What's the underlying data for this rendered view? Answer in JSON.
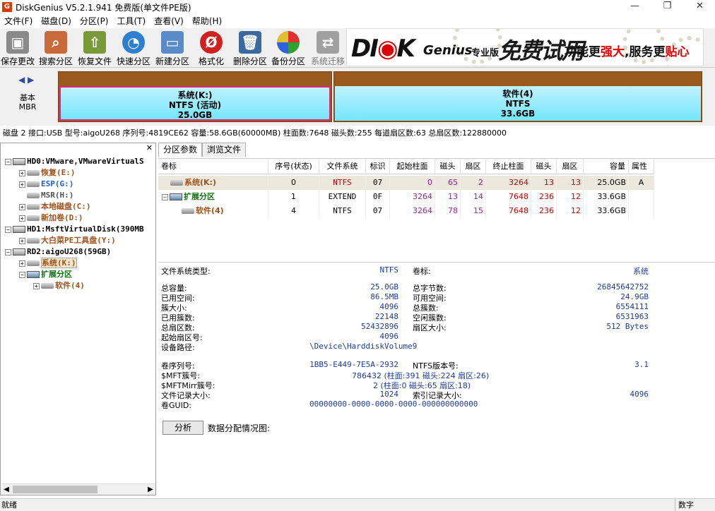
{
  "window": {
    "title": "DiskGenius V5.2.1.941 免费版(单文件PE版)"
  },
  "menu": [
    "文件(F)",
    "磁盘(D)",
    "分区(P)",
    "工具(T)",
    "查看(V)",
    "帮助(H)"
  ],
  "toolbar": {
    "save": "保存更改",
    "search": "搜索分区",
    "recover": "恢复文件",
    "quick": "快速分区",
    "new": "新建分区",
    "format": "格式化",
    "delete": "删除分区",
    "backup": "备份分区",
    "migrate": "系统迁移"
  },
  "banner": {
    "brand_a": "DI",
    "brand_b": "K",
    "brand_c": "Genius",
    "edition": "专业版",
    "trial": "免费试用",
    "slogan_a": "功能更",
    "slogan_b": "强大",
    "slogan_c": ",服务更",
    "slogan_d": "贴心"
  },
  "disk_view": {
    "type_label": "基本",
    "scheme_label": "MBR",
    "partitions": [
      {
        "name": "系统(K:)",
        "fs": "NTFS (活动)",
        "size": "25.0GB"
      },
      {
        "name": "软件(4)",
        "fs": "NTFS",
        "size": "33.6GB"
      }
    ]
  },
  "disk_info": "磁盘 2 接口:USB  型号:aigoU268  序列号:4819CE62  容量:58.6GB(60000MB)  柱面数:7648  磁头数:255  每道扇区数:63  总扇区数:122880000",
  "tree": {
    "hd0": "HD0:VMware,VMwareVirtualS",
    "hd0_items": [
      "恢复(E:)",
      "ESP(G:)",
      "MSR(H:)",
      "本地磁盘(C:)",
      "新加卷(D:)"
    ],
    "hd1": "HD1:MsftVirtualDisk(390MB",
    "hd1_items": [
      "大白菜PE工具盘(Y:)"
    ],
    "rd2": "RD2:aigoU268(59GB)",
    "rd2_items": [
      "系统(K:)",
      "扩展分区",
      "软件(4)"
    ]
  },
  "tabs": [
    "分区参数",
    "浏览文件"
  ],
  "table": {
    "headers": [
      "卷标",
      "序号(状态)",
      "文件系统",
      "标识",
      "起始柱面",
      "磁头",
      "扇区",
      "终止柱面",
      "磁头",
      "扇区",
      "容量",
      "属性"
    ],
    "rows": [
      [
        "系统(K:)",
        "0",
        "NTFS",
        "07",
        "0",
        "65",
        "2",
        "3264",
        "13",
        "13",
        "25.0GB",
        "A"
      ],
      [
        "扩展分区",
        "1",
        "EXTEND",
        "0F",
        "3264",
        "13",
        "14",
        "7648",
        "236",
        "12",
        "33.6GB",
        ""
      ],
      [
        "软件(4)",
        "4",
        "NTFS",
        "07",
        "3264",
        "78",
        "15",
        "7648",
        "236",
        "12",
        "33.6GB",
        ""
      ]
    ]
  },
  "details": {
    "fs_type_label": "文件系统类型:",
    "fs_type": "NTFS",
    "vol_label_label": "卷标:",
    "vol_label": "系统",
    "total_cap_label": "总容量:",
    "total_cap": "25.0GB",
    "total_bytes_label": "总字节数:",
    "total_bytes": "26845642752",
    "used_label": "已用空间:",
    "used": "86.5MB",
    "free_label": "可用空间:",
    "free": "24.9GB",
    "cluster_size_label": "簇大小:",
    "cluster_size": "4096",
    "total_clusters_label": "总簇数:",
    "total_clusters": "6554111",
    "used_clusters_label": "已用簇数:",
    "used_clusters": "22148",
    "free_clusters_label": "空闲簇数:",
    "free_clusters": "6531963",
    "total_sectors_label": "总扇区数:",
    "total_sectors": "52432896",
    "sector_size_label": "扇区大小:",
    "sector_size": "512 Bytes",
    "start_sector_label": "起始扇区号:",
    "start_sector": "4096",
    "device_path_label": "设备路径:",
    "device_path": "\\Device\\HarddiskVolume9",
    "serial_label": "卷序列号:",
    "serial": "1BB5-E449-7E5A-2932",
    "ntfs_ver_label": "NTFS版本号:",
    "ntfs_ver": "3.1",
    "mft_label": "$MFT簇号:",
    "mft": "786432 (柱面:391 磁头:224 扇区:26)",
    "mftmirr_label": "$MFTMirr簇号:",
    "mftmirr": "2 (柱面:0 磁头:65 扇区:18)",
    "file_rec_label": "文件记录大小:",
    "file_rec": "1024",
    "index_rec_label": "索引记录大小:",
    "index_rec": "4096",
    "guid_label": "卷GUID:",
    "guid": "00000000-0000-0000-0000-000000000000",
    "analyze": "分析",
    "map_label": "数据分配情况图:"
  },
  "status": {
    "left": "就绪",
    "right": "数字"
  }
}
